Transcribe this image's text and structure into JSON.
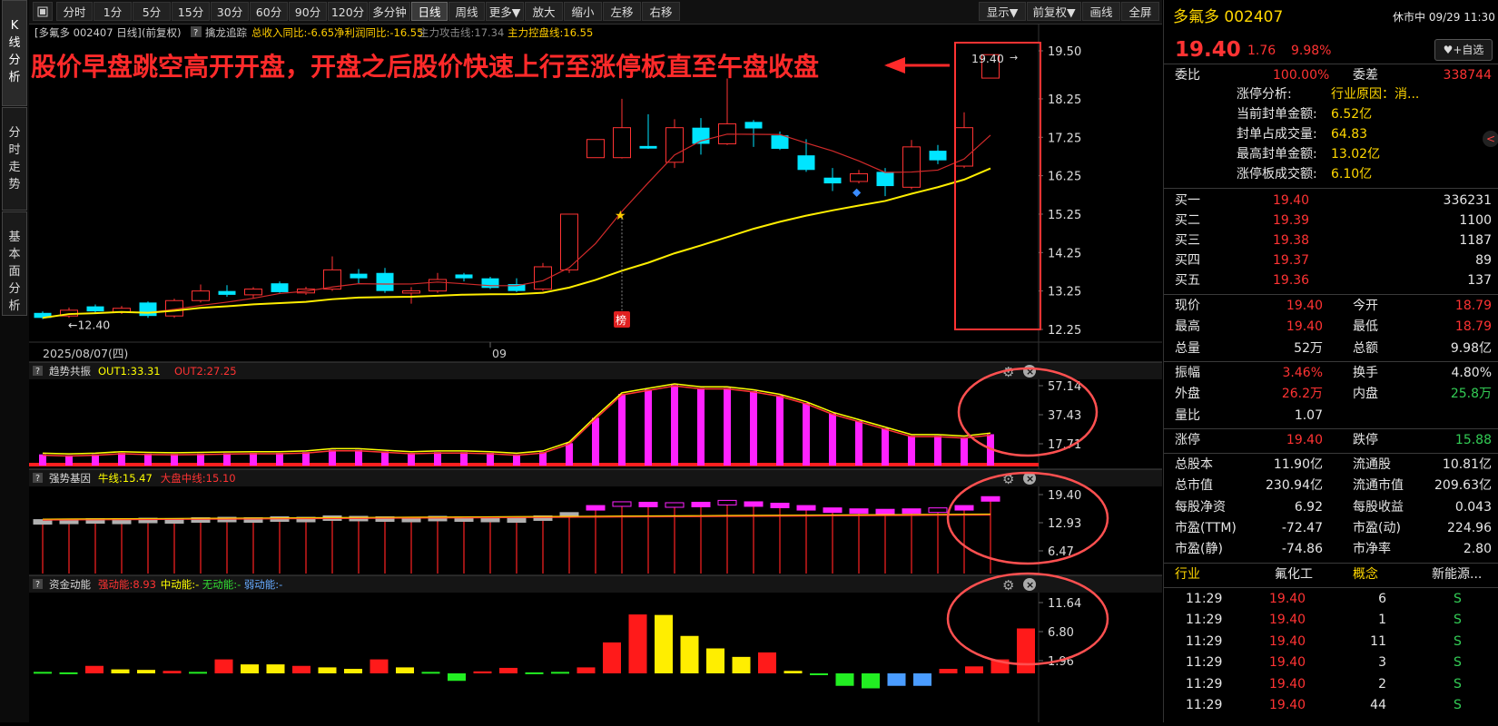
{
  "left_tabs": [
    "K线分析",
    "分时走势",
    "基本面分析"
  ],
  "toolbar": {
    "left": [
      "分时",
      "1分",
      "5分",
      "15分",
      "30分",
      "60分",
      "90分",
      "120分",
      "多分钟",
      "日线",
      "周线",
      "更多▼",
      "放大",
      "缩小",
      "左移",
      "右移"
    ],
    "right": [
      "显示▼",
      "前复权▼",
      "画线",
      "全屏"
    ],
    "active": "日线"
  },
  "chart_header": {
    "symbol": "[多氟多 002407 日线]",
    "adjust": "(前复权)",
    "indicator": "擒龙追踪",
    "rev_yoy": "总收入同比:-6.65",
    "profit_yoy": "净利润同比:-16.55",
    "attack_line": "主力攻击线:17.34",
    "control_line": "主力控盘线:16.55"
  },
  "annotation": "股价早盘跳空高开开盘，开盘之后股价快速上行至涨停板直至午盘收盘",
  "chart_data": [
    {
      "type": "candlestick",
      "y_axis": [
        "19.50",
        "18.25",
        "17.25",
        "16.25",
        "15.25",
        "14.25",
        "13.25",
        "12.25"
      ],
      "x_labels": [
        "2025/08/07(四)",
        "09"
      ],
      "low_label": "12.40",
      "last_label": "19.40",
      "badge": "榜",
      "candles": [
        {
          "o": 12.68,
          "c": 12.55,
          "h": 12.72,
          "l": 12.52
        },
        {
          "o": 12.6,
          "c": 12.75,
          "h": 12.82,
          "l": 12.55
        },
        {
          "o": 12.85,
          "c": 12.72,
          "h": 12.9,
          "l": 12.65
        },
        {
          "o": 12.7,
          "c": 12.8,
          "h": 12.86,
          "l": 12.65
        },
        {
          "o": 12.95,
          "c": 12.6,
          "h": 12.98,
          "l": 12.55
        },
        {
          "o": 12.6,
          "c": 13.0,
          "h": 13.05,
          "l": 12.55
        },
        {
          "o": 13.0,
          "c": 13.25,
          "h": 13.42,
          "l": 12.95
        },
        {
          "o": 13.25,
          "c": 13.15,
          "h": 13.4,
          "l": 13.1
        },
        {
          "o": 13.15,
          "c": 13.3,
          "h": 13.35,
          "l": 13.05
        },
        {
          "o": 13.45,
          "c": 13.22,
          "h": 13.5,
          "l": 13.2
        },
        {
          "o": 13.2,
          "c": 13.3,
          "h": 13.36,
          "l": 13.15
        },
        {
          "o": 13.3,
          "c": 13.8,
          "h": 14.15,
          "l": 13.25
        },
        {
          "o": 13.7,
          "c": 13.58,
          "h": 13.82,
          "l": 13.45
        },
        {
          "o": 13.72,
          "c": 13.25,
          "h": 13.85,
          "l": 13.2
        },
        {
          "o": 13.22,
          "c": 13.23,
          "h": 13.35,
          "l": 12.92
        },
        {
          "o": 13.25,
          "c": 13.55,
          "h": 13.72,
          "l": 13.2
        },
        {
          "o": 13.68,
          "c": 13.58,
          "h": 13.72,
          "l": 13.5
        },
        {
          "o": 13.58,
          "c": 13.33,
          "h": 13.62,
          "l": 13.3
        },
        {
          "o": 13.43,
          "c": 13.25,
          "h": 13.58,
          "l": 13.22
        },
        {
          "o": 13.3,
          "c": 13.88,
          "h": 13.98,
          "l": 13.25
        },
        {
          "o": 13.8,
          "c": 15.25,
          "h": 15.25,
          "l": 13.72
        },
        {
          "o": 16.72,
          "c": 16.72,
          "h": 16.72,
          "l": 16.72
        },
        {
          "o": 16.72,
          "c": 17.5,
          "h": 18.25,
          "l": 16.7
        },
        {
          "o": 17.0,
          "c": 16.98,
          "h": 17.85,
          "l": 16.95
        },
        {
          "o": 16.6,
          "c": 17.5,
          "h": 17.72,
          "l": 16.45
        },
        {
          "o": 17.5,
          "c": 17.08,
          "h": 17.75,
          "l": 16.8
        },
        {
          "o": 17.08,
          "c": 17.6,
          "h": 18.78,
          "l": 17.05
        },
        {
          "o": 17.65,
          "c": 17.48,
          "h": 17.7,
          "l": 17.0
        },
        {
          "o": 17.3,
          "c": 16.95,
          "h": 17.4,
          "l": 16.92
        },
        {
          "o": 16.78,
          "c": 16.4,
          "h": 17.2,
          "l": 16.35
        },
        {
          "o": 16.2,
          "c": 16.05,
          "h": 16.45,
          "l": 15.85
        },
        {
          "o": 16.1,
          "c": 16.3,
          "h": 16.4,
          "l": 16.05
        },
        {
          "o": 16.35,
          "c": 15.98,
          "h": 16.45,
          "l": 15.72
        },
        {
          "o": 15.95,
          "c": 17.0,
          "h": 17.18,
          "l": 15.9
        },
        {
          "o": 16.9,
          "c": 16.65,
          "h": 17.05,
          "l": 16.55
        },
        {
          "o": 16.5,
          "c": 17.5,
          "h": 17.9,
          "l": 16.45
        },
        {
          "o": 18.79,
          "c": 19.4,
          "h": 19.4,
          "l": 18.79
        }
      ]
    },
    {
      "type": "bar",
      "title": "趋势共振",
      "legend": [
        {
          "name": "OUT1:33.31",
          "color": "#ffff00"
        },
        {
          "name": "OUT2:27.25",
          "color": "#ff3333"
        }
      ],
      "y_axis": [
        "57.14",
        "37.43",
        "17.71"
      ],
      "values": [
        17.5,
        17.0,
        17.5,
        18.5,
        18.0,
        17.8,
        18.0,
        18.3,
        18.5,
        18.5,
        19.0,
        20.5,
        20.5,
        19.5,
        18.5,
        19.0,
        19.0,
        18.5,
        17.5,
        19.0,
        25,
        42,
        58,
        61,
        64,
        62,
        62,
        60,
        57,
        52,
        45,
        40,
        35,
        30,
        30,
        29,
        31,
        38
      ]
    },
    {
      "type": "bar",
      "title": "强势基因",
      "legend": [
        {
          "name": "牛线:15.47",
          "color": "#ffff00"
        },
        {
          "name": "大盘中线:15.10",
          "color": "#ff3333"
        }
      ],
      "y_axis": [
        "19.40",
        "12.93",
        "6.47"
      ],
      "values": [
        14.5,
        14.6,
        14.7,
        14.6,
        14.8,
        14.7,
        14.9,
        15.0,
        14.9,
        15.1,
        15.0,
        15.3,
        15.2,
        15.1,
        15.0,
        15.2,
        15.1,
        15.0,
        14.9,
        15.3,
        16.0,
        17.5,
        18.3,
        18.2,
        18.1,
        18.2,
        18.6,
        18.3,
        18.0,
        17.5,
        17.0,
        16.8,
        16.7,
        16.8,
        17.0,
        17.5,
        19.4
      ]
    },
    {
      "type": "bar",
      "title": "资金动能",
      "legend": [
        {
          "name": "强动能:8.93",
          "color": "#ff3333"
        },
        {
          "name": "中动能:-",
          "color": "#ffff00"
        },
        {
          "name": "无动能:-",
          "color": "#33dd33"
        },
        {
          "name": "弱动能:-",
          "color": "#66aaff"
        }
      ],
      "y_axis": [
        "11.64",
        "6.80",
        "1.96"
      ],
      "values": [
        0.3,
        0.2,
        1.5,
        0.8,
        0.7,
        0.5,
        0.3,
        2.8,
        1.8,
        1.8,
        1.5,
        1.2,
        0.9,
        2.8,
        1.2,
        0.3,
        -1.5,
        0.4,
        1.1,
        0.2,
        0.3,
        1.2,
        6.2,
        11.8,
        11.7,
        7.5,
        5.0,
        3.3,
        4.2,
        0.5,
        -0.3,
        -2.5,
        -3.0,
        -2.5,
        -2.5,
        0.9,
        1.4,
        2.8,
        9.0
      ],
      "colors": [
        "g",
        "g",
        "r",
        "y",
        "y",
        "r",
        "g",
        "r",
        "y",
        "y",
        "r",
        "y",
        "y",
        "r",
        "y",
        "g",
        "g",
        "r",
        "r",
        "g",
        "g",
        "r",
        "r",
        "r",
        "y",
        "y",
        "y",
        "y",
        "r",
        "y",
        "g",
        "g",
        "g",
        "b",
        "b",
        "r",
        "r",
        "r",
        "r"
      ]
    }
  ],
  "right_panel": {
    "name": "多氟多",
    "code": "002407",
    "status": "休市中",
    "datetime": "09/29 11:30",
    "price": "19.40",
    "change": "1.76",
    "change_pct": "9.98%",
    "watch_btn": "+自选",
    "webi_label": "委比",
    "webi_val": "100.00%",
    "weicha_label": "委差",
    "weicha_val": "338744",
    "limit_info": [
      {
        "label": "涨停分析:",
        "value": "行业原因：消..."
      },
      {
        "label": "当前封单金额:",
        "value": "6.52亿"
      },
      {
        "label": "封单占成交量:",
        "value": "64.83"
      },
      {
        "label": "最高封单金额:",
        "value": "13.02亿"
      },
      {
        "label": "涨停板成交额:",
        "value": "6.10亿"
      }
    ],
    "bids": [
      {
        "label": "买一",
        "price": "19.40",
        "vol": "336231"
      },
      {
        "label": "买二",
        "price": "19.39",
        "vol": "1100"
      },
      {
        "label": "买三",
        "price": "19.38",
        "vol": "1187"
      },
      {
        "label": "买四",
        "price": "19.37",
        "vol": "89"
      },
      {
        "label": "买五",
        "price": "19.36",
        "vol": "137"
      }
    ],
    "stats1": [
      {
        "l1": "现价",
        "v1": "19.40",
        "c1": "red",
        "l2": "今开",
        "v2": "18.79",
        "c2": "red"
      },
      {
        "l1": "最高",
        "v1": "19.40",
        "c1": "red",
        "l2": "最低",
        "v2": "18.79",
        "c2": "red"
      },
      {
        "l1": "总量",
        "v1": "52万",
        "c1": "wht",
        "l2": "总额",
        "v2": "9.98亿",
        "c2": "wht"
      }
    ],
    "stats2": [
      {
        "l1": "振幅",
        "v1": "3.46%",
        "c1": "red",
        "l2": "换手",
        "v2": "4.80%",
        "c2": "wht"
      },
      {
        "l1": "外盘",
        "v1": "26.2万",
        "c1": "red",
        "l2": "内盘",
        "v2": "25.8万",
        "c2": "grn"
      },
      {
        "l1": "量比",
        "v1": "1.07",
        "c1": "wht",
        "l2": "",
        "v2": "",
        "c2": "wht"
      }
    ],
    "stats3": [
      {
        "l1": "涨停",
        "v1": "19.40",
        "c1": "red",
        "l2": "跌停",
        "v2": "15.88",
        "c2": "grn"
      }
    ],
    "stats4": [
      {
        "l1": "总股本",
        "v1": "11.90亿",
        "c1": "wht",
        "l2": "流通股",
        "v2": "10.81亿",
        "c2": "wht"
      },
      {
        "l1": "总市值",
        "v1": "230.94亿",
        "c1": "wht",
        "l2": "流通市值",
        "v2": "209.63亿",
        "c2": "wht"
      },
      {
        "l1": "每股净资",
        "v1": "6.92",
        "c1": "wht",
        "l2": "每股收益",
        "v2": "0.043",
        "c2": "wht"
      },
      {
        "l1": "市盈(TTM)",
        "v1": "-72.47",
        "c1": "wht",
        "l2": "市盈(动)",
        "v2": "224.96",
        "c2": "wht"
      },
      {
        "l1": "市盈(静)",
        "v1": "-74.86",
        "c1": "wht",
        "l2": "市净率",
        "v2": "2.80",
        "c2": "wht"
      }
    ],
    "industry_label": "行业",
    "industry_val": "氟化工",
    "concept_label": "概念",
    "concept_val": "新能源...",
    "ticks": [
      {
        "t": "11:29",
        "p": "19.40",
        "v": "6",
        "s": "S"
      },
      {
        "t": "11:29",
        "p": "19.40",
        "v": "1",
        "s": "S"
      },
      {
        "t": "11:29",
        "p": "19.40",
        "v": "11",
        "s": "S"
      },
      {
        "t": "11:29",
        "p": "19.40",
        "v": "3",
        "s": "S"
      },
      {
        "t": "11:29",
        "p": "19.40",
        "v": "2",
        "s": "S"
      },
      {
        "t": "11:29",
        "p": "19.40",
        "v": "44",
        "s": "S"
      }
    ]
  }
}
